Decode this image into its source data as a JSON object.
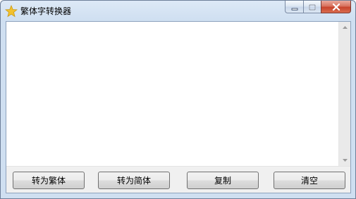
{
  "window": {
    "title": "繁体字转换器",
    "icon": "star-icon"
  },
  "caption": {
    "minimize_icon": "minimize-icon",
    "maximize_icon": "maximize-icon",
    "close_icon": "close-icon"
  },
  "editor": {
    "value": "",
    "scroll_up_icon": "scroll-up-arrow-icon",
    "scroll_down_icon": "scroll-down-arrow-icon"
  },
  "buttons": {
    "to_traditional": "转为繁体",
    "to_simplified": "转为简体",
    "copy": "复制",
    "clear": "清空"
  },
  "colors": {
    "close_button": "#c7432c",
    "frame": "#cfdff1",
    "star": "#f2c12e"
  }
}
